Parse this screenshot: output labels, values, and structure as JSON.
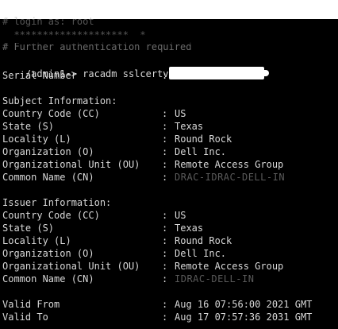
{
  "obscured": {
    "line1": "# login as: root",
    "line2": "  ********************  *",
    "line3": "# Further authentication required"
  },
  "prompt": "/admin1-> racadm sslcertview -t 1",
  "serial": {
    "label": "Serial Number",
    "sep": ":"
  },
  "subject": {
    "heading": "Subject Information:",
    "rows": [
      {
        "label": "Country Code (CC)",
        "sep": ":",
        "value": "US"
      },
      {
        "label": "State (S)",
        "sep": ":",
        "value": "Texas"
      },
      {
        "label": "Locality (L)",
        "sep": ":",
        "value": "Round Rock"
      },
      {
        "label": "Organization (O)",
        "sep": ":",
        "value": "Dell Inc."
      },
      {
        "label": "Organizational Unit (OU)",
        "sep": ":",
        "value": "Remote Access Group"
      },
      {
        "label": "Common Name (CN)",
        "sep": ":",
        "value": "DRAC-IDRAC-DELL-IN"
      }
    ]
  },
  "issuer": {
    "heading": "Issuer Information:",
    "rows": [
      {
        "label": "Country Code (CC)",
        "sep": ":",
        "value": "US"
      },
      {
        "label": "State (S)",
        "sep": ":",
        "value": "Texas"
      },
      {
        "label": "Locality (L)",
        "sep": ":",
        "value": "Round Rock"
      },
      {
        "label": "Organization (O)",
        "sep": ":",
        "value": "Dell Inc."
      },
      {
        "label": "Organizational Unit (OU)",
        "sep": ":",
        "value": "Remote Access Group"
      },
      {
        "label": "Common Name (CN)",
        "sep": ":",
        "value": "IDRAC-DELL-IN"
      }
    ]
  },
  "validity": {
    "from": {
      "label": "Valid From",
      "sep": ":",
      "value": "Aug 16 07:56:00 2021 GMT"
    },
    "to": {
      "label": "Valid To",
      "sep": ":",
      "value": "Aug 17 07:57:36 2031 GMT"
    }
  }
}
